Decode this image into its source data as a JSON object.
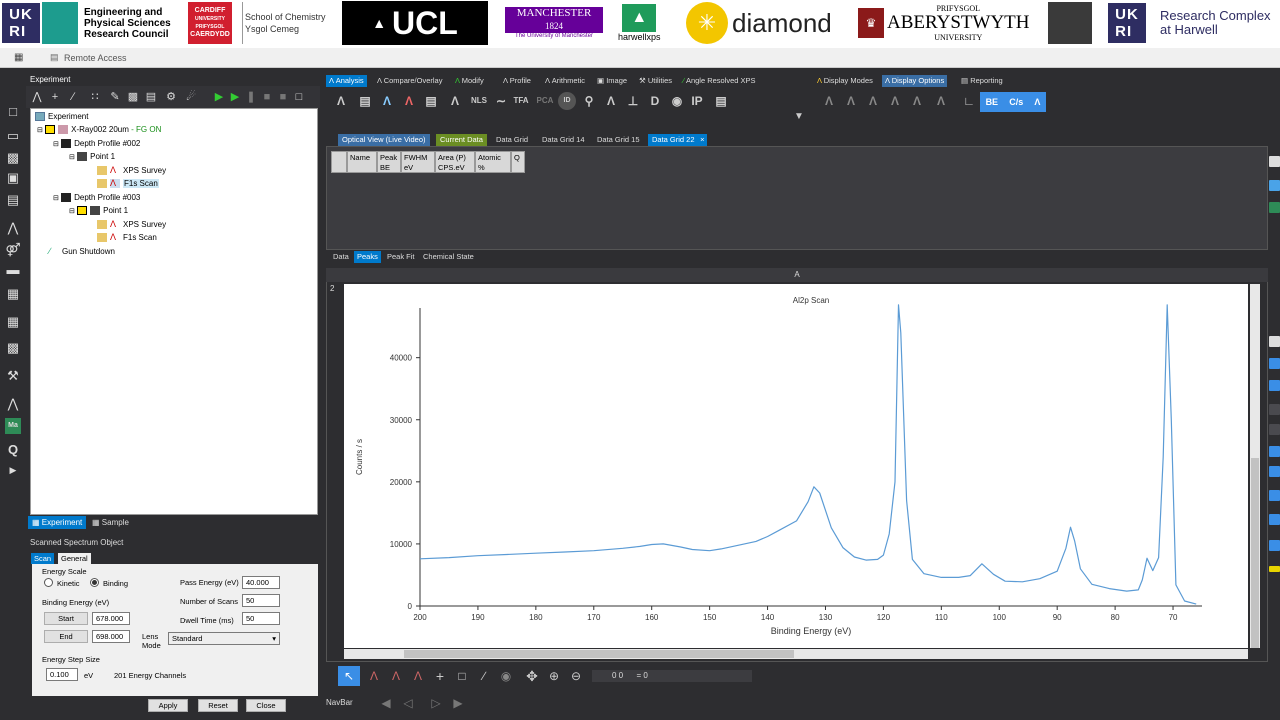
{
  "banner": {
    "epsrc_line1": "Engineering and",
    "epsrc_line2": "Physical Sciences",
    "epsrc_line3": "Research Council",
    "cardiff_top": "CARDIFF",
    "cardiff_mid": "UNIVERSITY",
    "cardiff_bot1": "PRIFYSGOL",
    "cardiff_bot2": "CAERDYDD",
    "chem_line1": "School of Chemistry",
    "chem_line2": "Ysgol Cemeg",
    "ucl": "UCL",
    "manchester": "MANCHESTER",
    "manchester_year": "1824",
    "manchester_sub": "The University of Manchester",
    "harwell": "harwellxps",
    "diamond": "diamond",
    "aber_top": "PRIFYSGOL",
    "aber_mid": "ABERYSTWYTH",
    "aber_bot": "UNIVERSITY",
    "rch_line1": "Research Complex",
    "rch_line2": "at Harwell"
  },
  "remote": {
    "label": "Remote Access"
  },
  "experiment": {
    "header": "Experiment",
    "tree": [
      {
        "label": "Experiment"
      },
      {
        "label": "X-Ray002 20um",
        "status": "- FG ON"
      },
      {
        "label": "Depth Profile #002"
      },
      {
        "label": "Point 1"
      },
      {
        "label": "XPS Survey"
      },
      {
        "label": "F1s Scan"
      },
      {
        "label": "Depth Profile #003"
      },
      {
        "label": "Point 1"
      },
      {
        "label": "XPS Survey"
      },
      {
        "label": "F1s Scan"
      },
      {
        "label": "Gun Shutdown"
      }
    ],
    "tabs": [
      "Experiment",
      "Sample"
    ]
  },
  "sso": {
    "title": "Scanned Spectrum Object",
    "tabs": [
      "Scan",
      "General"
    ],
    "energy_scale": "Energy Scale",
    "kinetic": "Kinetic",
    "binding": "Binding",
    "binding_energy": "Binding Energy (eV)",
    "start_label": "Start",
    "start_value": "678.000",
    "end_label": "End",
    "end_value": "698.000",
    "pass_energy_label": "Pass Energy (eV)",
    "pass_energy_value": "40.000",
    "num_scans_label": "Number of Scans",
    "num_scans_value": "50",
    "dwell_label": "Dwell Time (ms)",
    "dwell_value": "50",
    "lens_label1": "Lens",
    "lens_label2": "Mode",
    "lens_value": "Standard",
    "step_label": "Energy Step Size",
    "step_value": "0.100",
    "step_unit": "eV",
    "channels": "201 Energy Channels",
    "apply": "Apply",
    "reset": "Reset",
    "close": "Close"
  },
  "ribbon": {
    "tabs": [
      "Analysis",
      "Compare/Overlay",
      "Modify",
      "Profile",
      "Arithmetic",
      "Image",
      "Utilities",
      "Angle Resolved XPS",
      "Display Modes",
      "Display Options",
      "Reporting"
    ],
    "be": "BE",
    "cs": "C/s"
  },
  "datatabs": [
    "Optical View (Live Video)",
    "Current Data",
    "Data Grid",
    "Data Grid 14",
    "Data Grid 15",
    "Data Grid 22"
  ],
  "grid_headers": [
    {
      "l1": "Name",
      "l2": ""
    },
    {
      "l1": "Peak",
      "l2": "BE"
    },
    {
      "l1": "FWHM",
      "l2": "eV"
    },
    {
      "l1": "Area (P)",
      "l2": "CPS.eV"
    },
    {
      "l1": "Atomic",
      "l2": "%"
    },
    {
      "l1": "Q",
      "l2": ""
    }
  ],
  "peak_tabs": [
    "Data",
    "Peaks",
    "Peak Fit",
    "Chemical State"
  ],
  "chart_header": "A",
  "chart_index": "2",
  "navbar_label": "NavBar",
  "nav_readout": "0 0      = 0",
  "chart_data": {
    "type": "line",
    "title": "Al2p Scan",
    "xlabel": "Binding Energy (eV)",
    "ylabel": "Counts / s",
    "xlim": [
      200,
      65
    ],
    "ylim": [
      0,
      48000
    ],
    "x_ticks": [
      200,
      190,
      180,
      170,
      160,
      150,
      140,
      130,
      120,
      110,
      100,
      90,
      80,
      70
    ],
    "y_ticks": [
      0,
      10000,
      20000,
      30000,
      40000
    ],
    "color": "#5b9bd5",
    "series": [
      {
        "x": [
          200,
          195,
          190,
          185,
          180,
          175,
          170,
          165,
          162,
          160,
          158,
          155,
          153,
          150,
          148,
          145,
          142,
          140,
          138,
          135,
          133,
          132,
          131,
          129,
          127,
          125,
          123,
          121,
          120,
          119,
          118,
          117.4,
          117,
          116,
          115,
          113,
          110,
          107,
          105,
          103,
          101,
          99,
          96,
          93,
          90,
          88.5,
          87.7,
          87,
          86,
          84,
          81,
          78,
          76,
          75.3,
          74.5,
          73.5,
          72.5,
          71.7,
          71,
          70.3,
          69.5,
          68,
          66
        ],
        "y": [
          7600,
          7800,
          8100,
          8300,
          8500,
          8700,
          8900,
          9300,
          9600,
          9900,
          10000,
          9500,
          9100,
          8900,
          9200,
          9800,
          10400,
          11200,
          12200,
          13700,
          16800,
          19200,
          18200,
          12600,
          9400,
          7900,
          7400,
          7500,
          8200,
          11600,
          20000,
          48500,
          44000,
          17000,
          7500,
          5200,
          4600,
          4600,
          4900,
          6800,
          5100,
          4000,
          3900,
          4400,
          5600,
          9300,
          12700,
          10500,
          6000,
          3500,
          2800,
          2400,
          2600,
          4200,
          7700,
          5700,
          7800,
          24000,
          48500,
          30000,
          3400,
          800,
          300
        ]
      }
    ]
  }
}
